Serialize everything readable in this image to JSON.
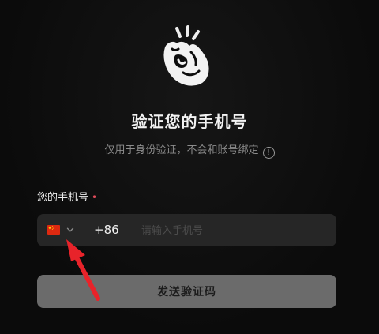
{
  "header": {
    "logo_icon": "ok-hand-icon",
    "title": "验证您的手机号",
    "subtitle": "仅用于身份验证，不会和账号绑定",
    "info_icon_glyph": "!"
  },
  "phone_field": {
    "label": "您的手机号",
    "required_marker": "•",
    "country_flag": "china-flag-icon",
    "dial_code": "+86",
    "placeholder": "请输入手机号",
    "value": ""
  },
  "actions": {
    "send_code_label": "发送验证码"
  },
  "annotation": {
    "arrow_icon": "red-arrow-icon",
    "arrow_color": "#e8232a"
  },
  "colors": {
    "background": "#0d0d0d",
    "input_bg": "#262626",
    "button_bg": "#6b6b6b",
    "required": "#e04b5a",
    "flag_red": "#de2910",
    "flag_yellow": "#ffde00"
  }
}
